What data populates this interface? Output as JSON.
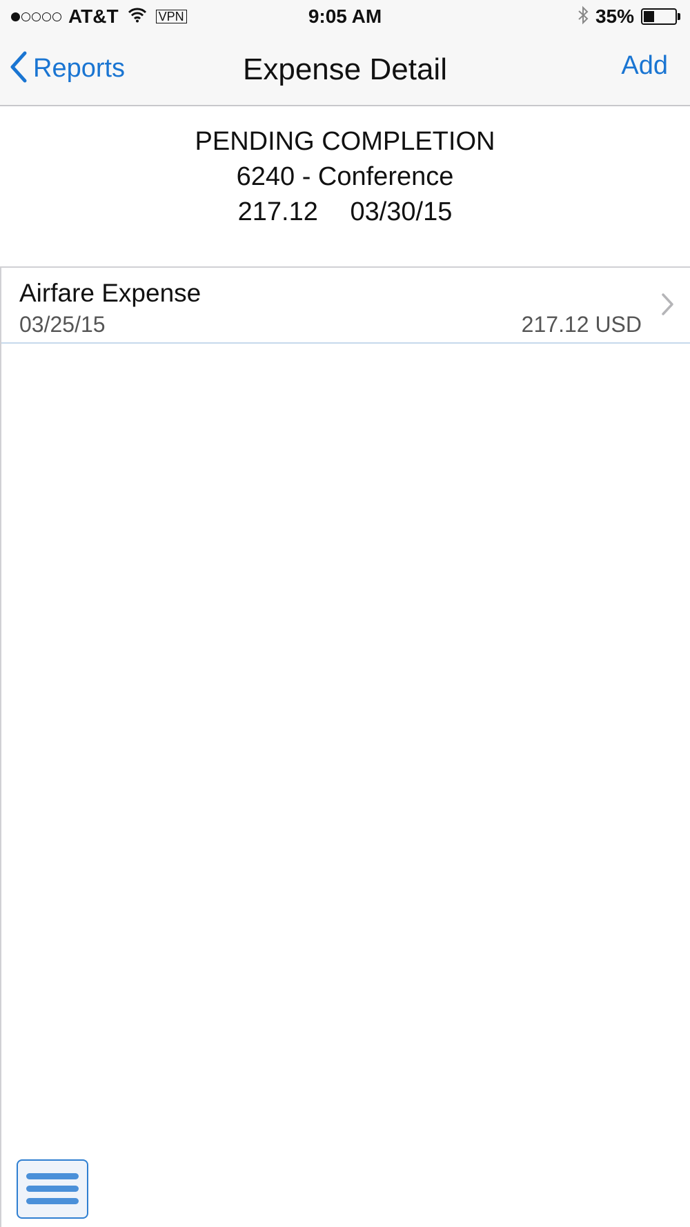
{
  "status_bar": {
    "carrier": "AT&T",
    "vpn": "VPN",
    "time": "9:05 AM",
    "battery_percent": "35%",
    "battery_level": 0.35,
    "signal_bars_filled": 1,
    "signal_bars_total": 5
  },
  "nav": {
    "back_label": "Reports",
    "title": "Expense Detail",
    "add_label": "Add"
  },
  "report": {
    "status": "PENDING COMPLETION",
    "name": "6240 - Conference",
    "amount": "217.12",
    "date": "03/30/15"
  },
  "expenses": [
    {
      "title": "Airfare Expense",
      "date": "03/25/15",
      "amount": "217.12 USD"
    }
  ],
  "colors": {
    "accent": "#1a75d2",
    "menu_accent": "#4a90d9"
  },
  "icons": {
    "back": "chevron-left-icon",
    "row": "chevron-right-icon",
    "menu": "hamburger-menu-icon",
    "wifi": "wifi-icon",
    "bluetooth": "bluetooth-icon",
    "battery": "battery-icon"
  }
}
